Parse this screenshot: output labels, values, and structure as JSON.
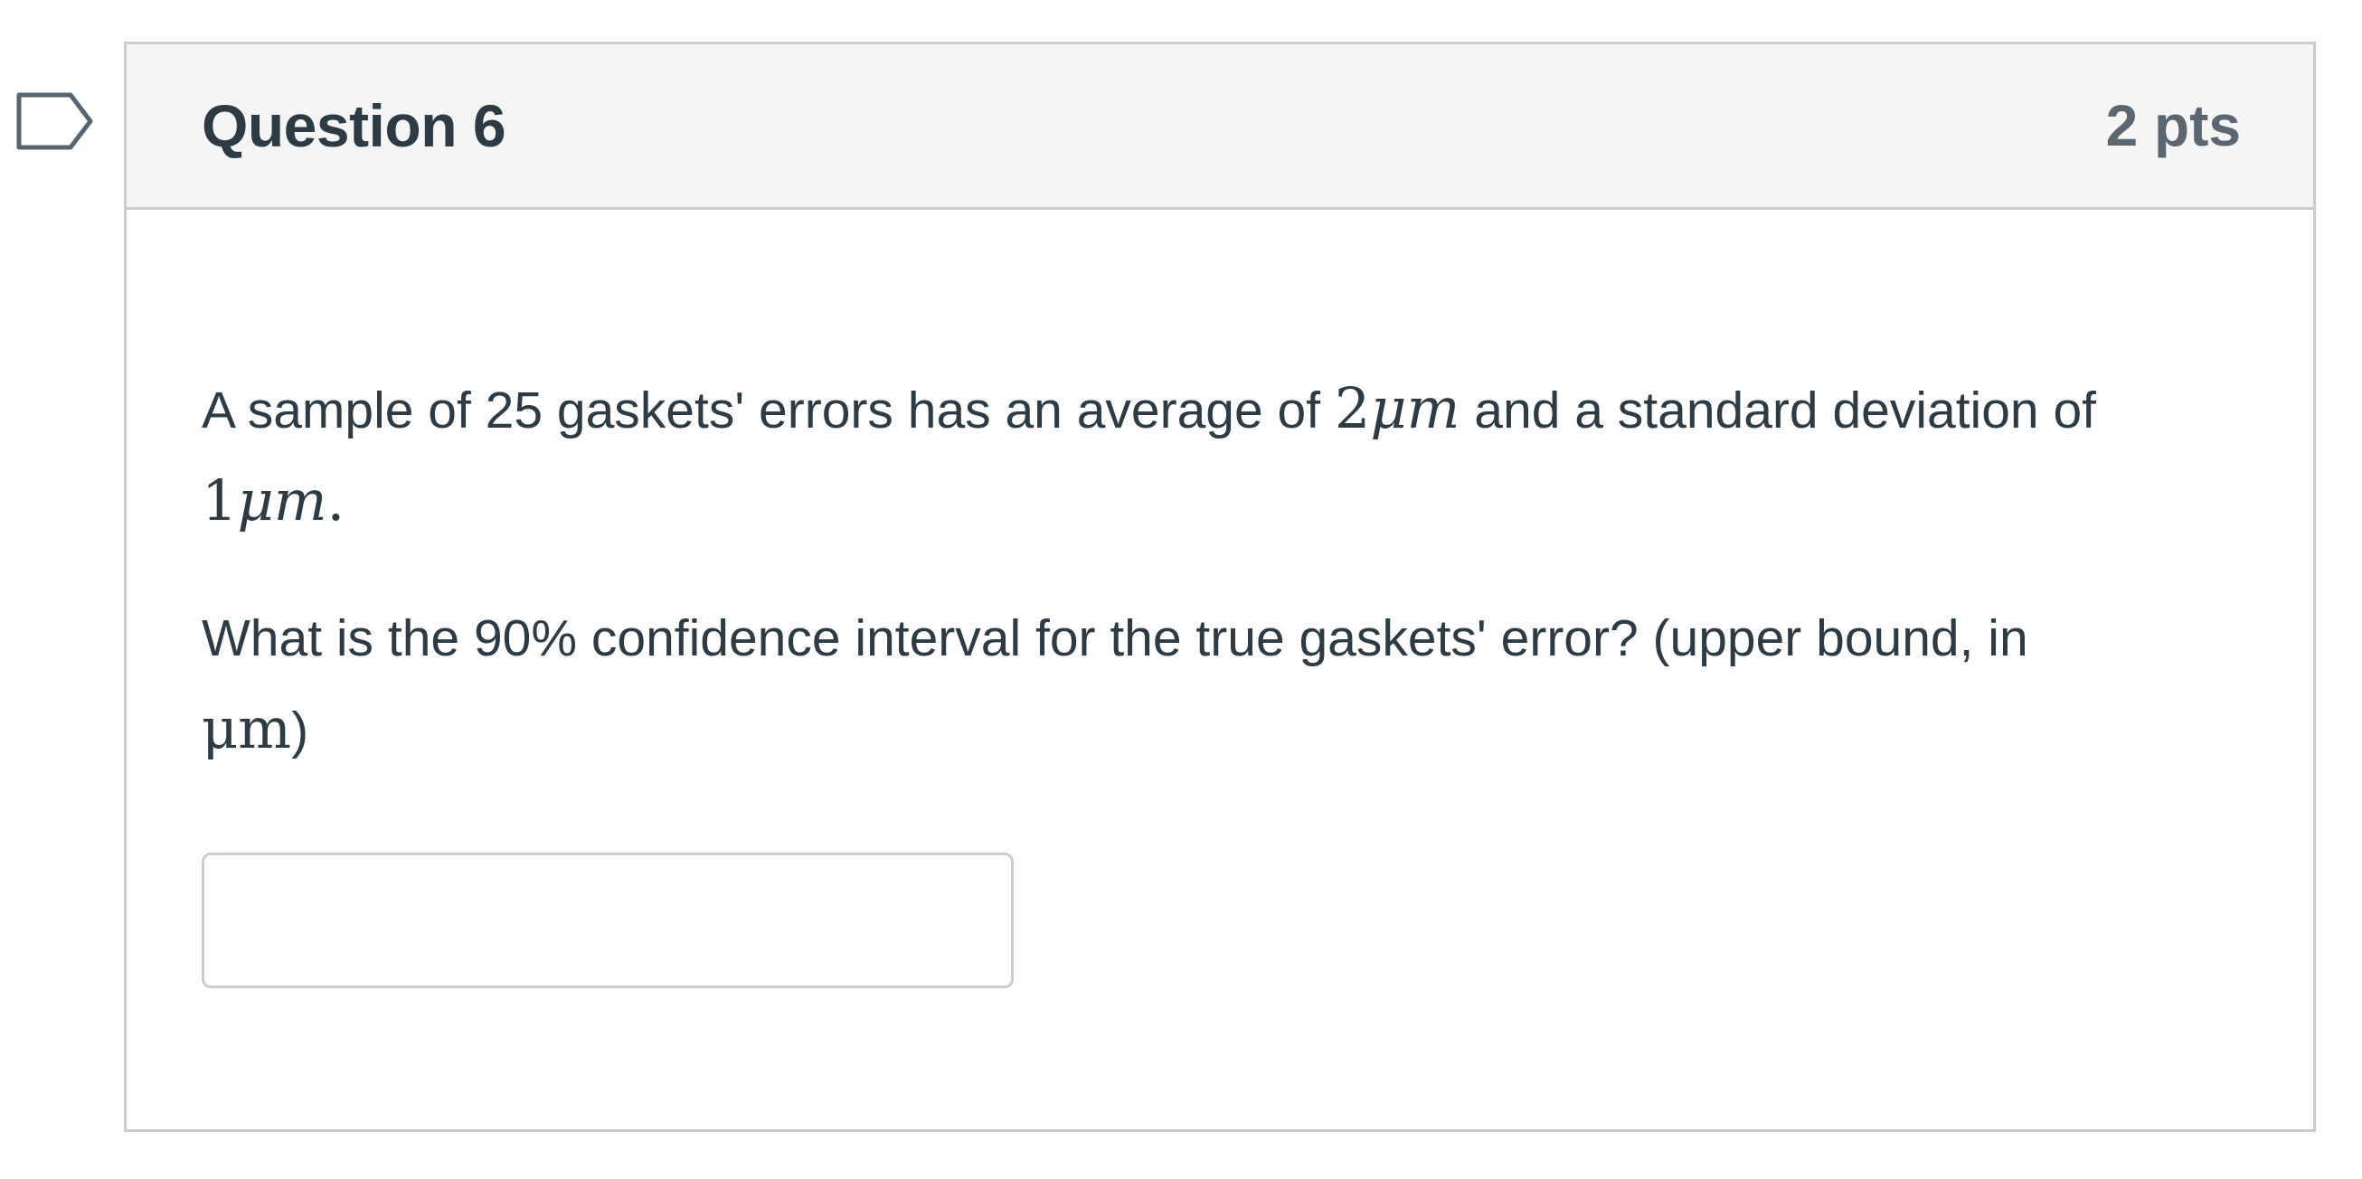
{
  "question": {
    "title": "Question 6",
    "points": "2 pts",
    "flag_icon": "bookmark-flag-icon",
    "paragraph1": {
      "before_avg": "A sample of 25 gaskets' errors has an average of ",
      "avg_number": "2",
      "avg_unit": "μm",
      "middle": " and a standard deviation of ",
      "std_number": "1",
      "std_unit": "μm",
      "end": "."
    },
    "paragraph2": {
      "text": "What is the 90% confidence interval for the true gaskets' error? (upper bound, in ",
      "unit": "μm",
      "end": ")"
    },
    "answer": {
      "value": "",
      "placeholder": ""
    }
  },
  "colors": {
    "text": "#2d3b45",
    "points_text": "#5b6770",
    "border": "#c7cdd1",
    "header_background": "#f5f5f5"
  }
}
